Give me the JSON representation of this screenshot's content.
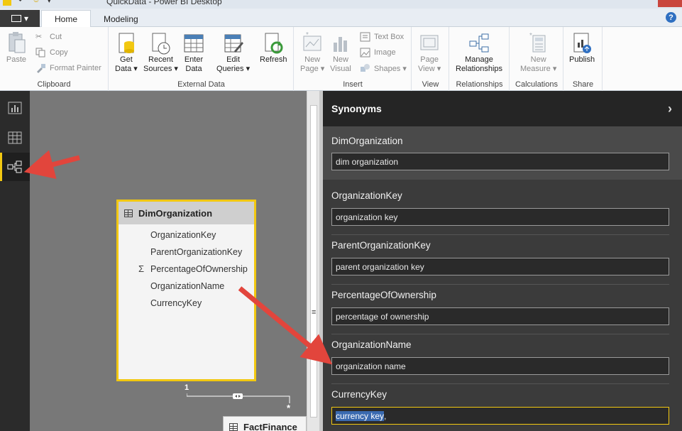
{
  "window": {
    "title": "QuickData - Power BI Desktop"
  },
  "tabs": {
    "home": "Home",
    "modeling": "Modeling"
  },
  "ribbon": {
    "clipboard": {
      "paste": "Paste",
      "cut": "Cut",
      "copy": "Copy",
      "format_painter": "Format Painter",
      "label": "Clipboard"
    },
    "external_data": {
      "get_data": [
        "Get",
        "Data ▾"
      ],
      "recent_sources": [
        "Recent",
        "Sources ▾"
      ],
      "enter_data": [
        "Enter",
        "Data"
      ],
      "edit_queries": [
        "Edit",
        "Queries ▾"
      ],
      "refresh": "Refresh",
      "label": "External Data"
    },
    "insert": {
      "new_page": [
        "New",
        "Page ▾"
      ],
      "new_visual": [
        "New",
        "Visual"
      ],
      "text_box": "Text Box",
      "image": "Image",
      "shapes": "Shapes ▾",
      "label": "Insert"
    },
    "view": {
      "page_view": [
        "Page",
        "View ▾"
      ],
      "label": "View"
    },
    "relationships": {
      "manage": [
        "Manage",
        "Relationships"
      ],
      "label": "Relationships"
    },
    "calculations": {
      "new_measure": [
        "New",
        "Measure ▾"
      ],
      "label": "Calculations"
    },
    "share": {
      "publish": "Publish",
      "label": "Share"
    }
  },
  "canvas": {
    "table_card": {
      "name": "DimOrganization",
      "fields": [
        "OrganizationKey",
        "ParentOrganizationKey",
        "PercentageOfOwnership",
        "OrganizationName",
        "CurrencyKey"
      ],
      "sigma": "Σ"
    },
    "relationship": {
      "one": "1",
      "many": "*"
    },
    "fact_card": {
      "name": "FactFinance"
    },
    "scroll_grip": "≡"
  },
  "synonyms": {
    "title": "Synonyms",
    "chevron": "›",
    "table": {
      "name": "DimOrganization",
      "value": "dim organization"
    },
    "columns": [
      {
        "name": "OrganizationKey",
        "value": "organization key"
      },
      {
        "name": "ParentOrganizationKey",
        "value": "parent organization key"
      },
      {
        "name": "PercentageOfOwnership",
        "value": "percentage of ownership"
      },
      {
        "name": "OrganizationName",
        "value": "organization name"
      },
      {
        "name": "CurrencyKey",
        "value_selected": "currency key",
        "value_rest": ","
      }
    ]
  },
  "colors": {
    "accent_yellow": "#f2c811",
    "arrow_red": "#e2453c",
    "pane_dark": "#3b3b3b",
    "canvas_gray": "#787878"
  }
}
